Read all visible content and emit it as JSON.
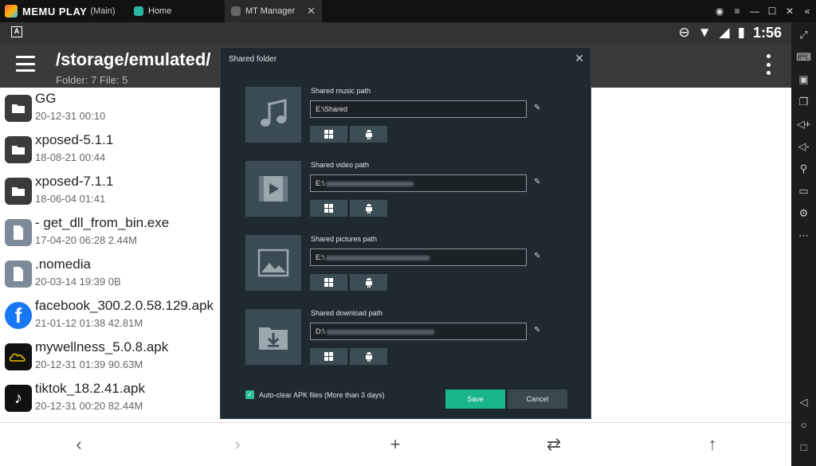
{
  "emulator": {
    "brand": "MEMU PLAY",
    "instance": "(Main)",
    "tabs": [
      {
        "label": "Home"
      },
      {
        "label": "MT Manager"
      }
    ]
  },
  "statusbar": {
    "time": "1:56"
  },
  "appbar": {
    "path": "/storage/emulated/",
    "counts": "Folder: 7  File: 5"
  },
  "files": [
    {
      "name": "GG",
      "meta": "20-12-31 00:10",
      "kind": "folder"
    },
    {
      "name": "xposed-5.1.1",
      "meta": "18-08-21 00:44",
      "kind": "folder"
    },
    {
      "name": "xposed-7.1.1",
      "meta": "18-06-04 01:41",
      "kind": "folder"
    },
    {
      "name": "- get_dll_from_bin.exe",
      "meta": "17-04-20 06:28  2.44M",
      "kind": "doc"
    },
    {
      "name": ".nomedia",
      "meta": "20-03-14 19:39  0B",
      "kind": "doc"
    },
    {
      "name": "facebook_300.2.0.58.129.apk",
      "meta": "21-01-12 01:38  42.81M",
      "kind": "facebook"
    },
    {
      "name": "mywellness_5.0.8.apk",
      "meta": "20-12-31 01:39  90.63M",
      "kind": "mywellness"
    },
    {
      "name": "tiktok_18.2.41.apk",
      "meta": "20-12-31 00:20  82.44M",
      "kind": "tiktok"
    }
  ],
  "dialog": {
    "title": "Shared folder",
    "entries": [
      {
        "label": "Shared music path",
        "value": "E:\\Shared"
      },
      {
        "label": "Shared video path",
        "value": "E:\\"
      },
      {
        "label": "Shared pictures path",
        "value": "E:\\"
      },
      {
        "label": "Shared download path",
        "value": "D:\\"
      }
    ],
    "autoclear_label": "Auto-clear APK files (More than 3 days)",
    "save_label": "Save",
    "cancel_label": "Cancel"
  },
  "colors": {
    "accent": "#19b58c",
    "dialog_bg": "#1f2a30",
    "appbar": "#3a3a3a"
  }
}
